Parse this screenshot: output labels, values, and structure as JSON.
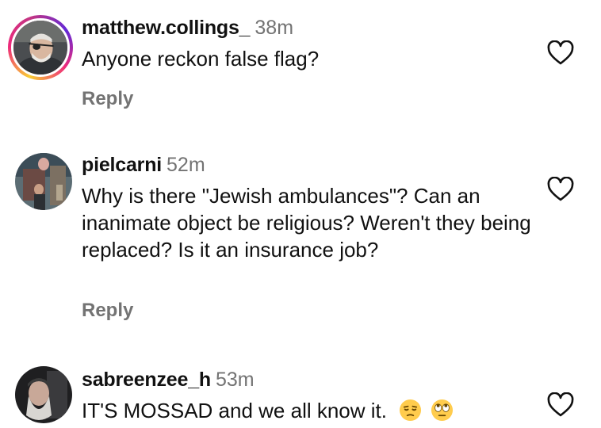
{
  "comments": [
    {
      "username": "matthew.collings_",
      "time": "38m",
      "text": "Anyone reckon false flag?",
      "reply_label": "Reply",
      "like_icon": "heart-outline-icon",
      "avatar_has_story_ring": true
    },
    {
      "username": "pielcarni",
      "time": "52m",
      "text": "Why is there \"Jewish ambulances\"? Can an inanimate object be religious? Weren't they being replaced? Is it an insurance job?",
      "reply_label": "Reply",
      "like_icon": "heart-outline-icon",
      "avatar_has_story_ring": false
    },
    {
      "username": "sabreenzee_h",
      "time": "53m",
      "text": "IT'S MOSSAD and we all know it.",
      "emojis": [
        "unamused-face-emoji",
        "eye-roll-face-emoji"
      ],
      "like_icon": "heart-outline-icon",
      "avatar_has_story_ring": false
    }
  ],
  "colors": {
    "text_primary": "#111111",
    "text_secondary": "#737373",
    "background": "#ffffff"
  }
}
